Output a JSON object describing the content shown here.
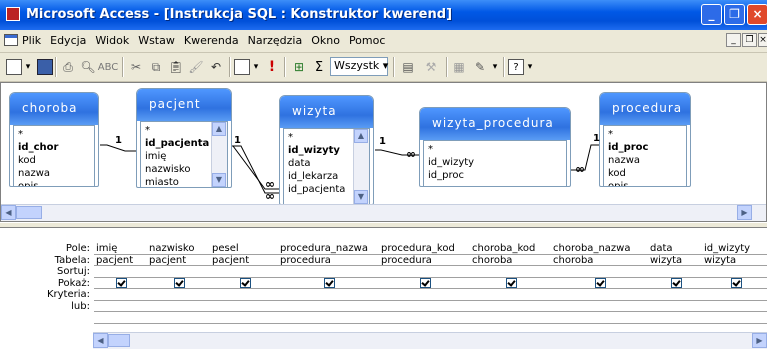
{
  "window": {
    "title": "Microsoft Access - [Instrukcja SQL : Konstruktor kwerend]"
  },
  "menu": {
    "items": [
      "Plik",
      "Edycja",
      "Widok",
      "Wstaw",
      "Kwerenda",
      "Narzędzia",
      "Okno",
      "Pomoc"
    ]
  },
  "toolbar": {
    "dropdown_value": "Wszystk",
    "sigma": "Σ",
    "run": "!"
  },
  "tables": [
    {
      "title": "choroba",
      "fields": [
        "*",
        "id_chor",
        "kod",
        "nazwa",
        "opis"
      ],
      "key": "id_chor"
    },
    {
      "title": "pacjent",
      "fields": [
        "*",
        "id_pacjenta",
        "imię",
        "nazwisko",
        "miasto"
      ],
      "key": "id_pacjenta"
    },
    {
      "title": "wizyta",
      "fields": [
        "*",
        "id_wizyty",
        "data",
        "id_lekarza",
        "id_pacjenta"
      ],
      "key": "id_wizyty"
    },
    {
      "title": "wizyta_procedura",
      "fields": [
        "*",
        "id_wizyty",
        "id_proc"
      ],
      "key": ""
    },
    {
      "title": "procedura",
      "fields": [
        "*",
        "id_proc",
        "nazwa",
        "kod",
        "opis"
      ],
      "key": "id_proc"
    }
  ],
  "relations": {
    "one": "1",
    "many": "∞"
  },
  "grid": {
    "row_labels": [
      "Pole:",
      "Tabela:",
      "Sortuj:",
      "Pokaż:",
      "Kryteria:",
      "lub:"
    ],
    "columns": [
      {
        "field": "imię",
        "table": "pacjent",
        "show": true
      },
      {
        "field": "nazwisko",
        "table": "pacjent",
        "show": true
      },
      {
        "field": "pesel",
        "table": "pacjent",
        "show": true
      },
      {
        "field": "procedura_nazwa",
        "table": "procedura",
        "show": true
      },
      {
        "field": "procedura_kod",
        "table": "procedura",
        "show": true
      },
      {
        "field": "choroba_kod",
        "table": "choroba",
        "show": true
      },
      {
        "field": "choroba_nazwa",
        "table": "choroba",
        "show": true
      },
      {
        "field": "data",
        "table": "wizyta",
        "show": true
      },
      {
        "field": "id_wizyty",
        "table": "wizyta",
        "show": true
      }
    ]
  }
}
